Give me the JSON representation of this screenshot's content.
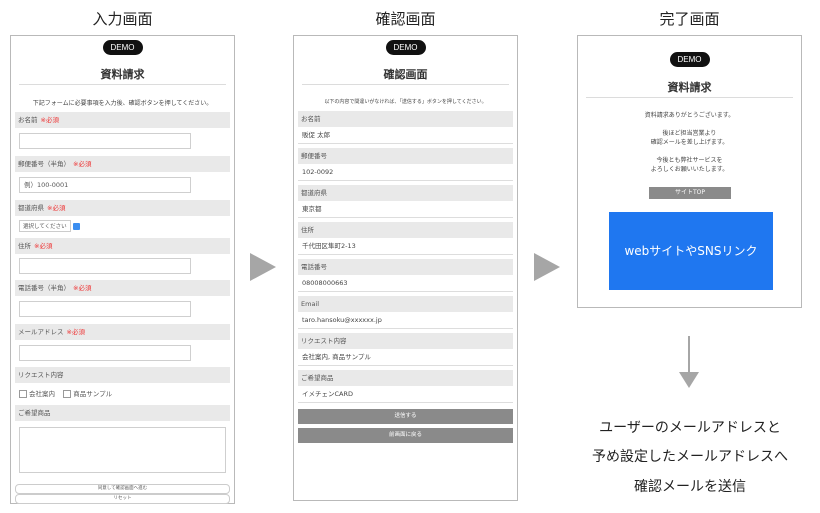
{
  "titles": {
    "input": "入力画面",
    "confirm": "確認画面",
    "complete": "完了画面"
  },
  "demo_label": "DEMO",
  "input_screen": {
    "heading": "資料請求",
    "intro": "下記フォームに必要事項を入力後、確認ボタンを押してください。",
    "required_mark": "※必須",
    "fields": {
      "name": "お名前",
      "zip": "郵便番号（半角）",
      "zip_placeholder": "例）100-0001",
      "pref": "都道府県",
      "pref_select": "選択してください",
      "address": "住所",
      "phone": "電話番号（半角）",
      "email": "メールアドレス",
      "request": "リクエスト内容",
      "option1": "会社案内",
      "option2": "商品サンプル",
      "product": "ご希望商品"
    },
    "confirm_button": "同意して確認画面へ進む",
    "reset_button": "リセット"
  },
  "confirm_screen": {
    "heading": "確認画面",
    "intro": "以下の内容で間違いがなければ、「送信する」ボタンを押してください。",
    "rows": [
      {
        "label": "お名前",
        "value": "販促 太郎"
      },
      {
        "label": "郵便番号",
        "value": "102-0092"
      },
      {
        "label": "都道府県",
        "value": "東京都"
      },
      {
        "label": "住所",
        "value": "千代田区隼町2-13"
      },
      {
        "label": "電話番号",
        "value": "08008000663"
      },
      {
        "label": "Email",
        "value": "taro.hansoku@xxxxxx.jp"
      },
      {
        "label": "リクエスト内容",
        "value": "会社案内, 商品サンプル"
      },
      {
        "label": "ご希望商品",
        "value": "イメチェンCARD"
      }
    ],
    "send_button": "送信する",
    "back_button": "前画面に戻る"
  },
  "complete_screen": {
    "heading": "資料請求",
    "thanks": "資料請求ありがとうございます。",
    "msg1a": "後ほど担当営業より",
    "msg1b": "確認メールを差し上げます。",
    "msg2a": "今後とも弊社サービスを",
    "msg2b": "よろしくお願いいたします。",
    "top_button": "サイトTOP",
    "banner": "webサイトやSNSリンク",
    "banner_color": "#1f77f0"
  },
  "description": {
    "line1": "ユーザーのメールアドレスと",
    "line2": "予め設定したメールアドレスへ",
    "line3": "確認メールを送信"
  }
}
